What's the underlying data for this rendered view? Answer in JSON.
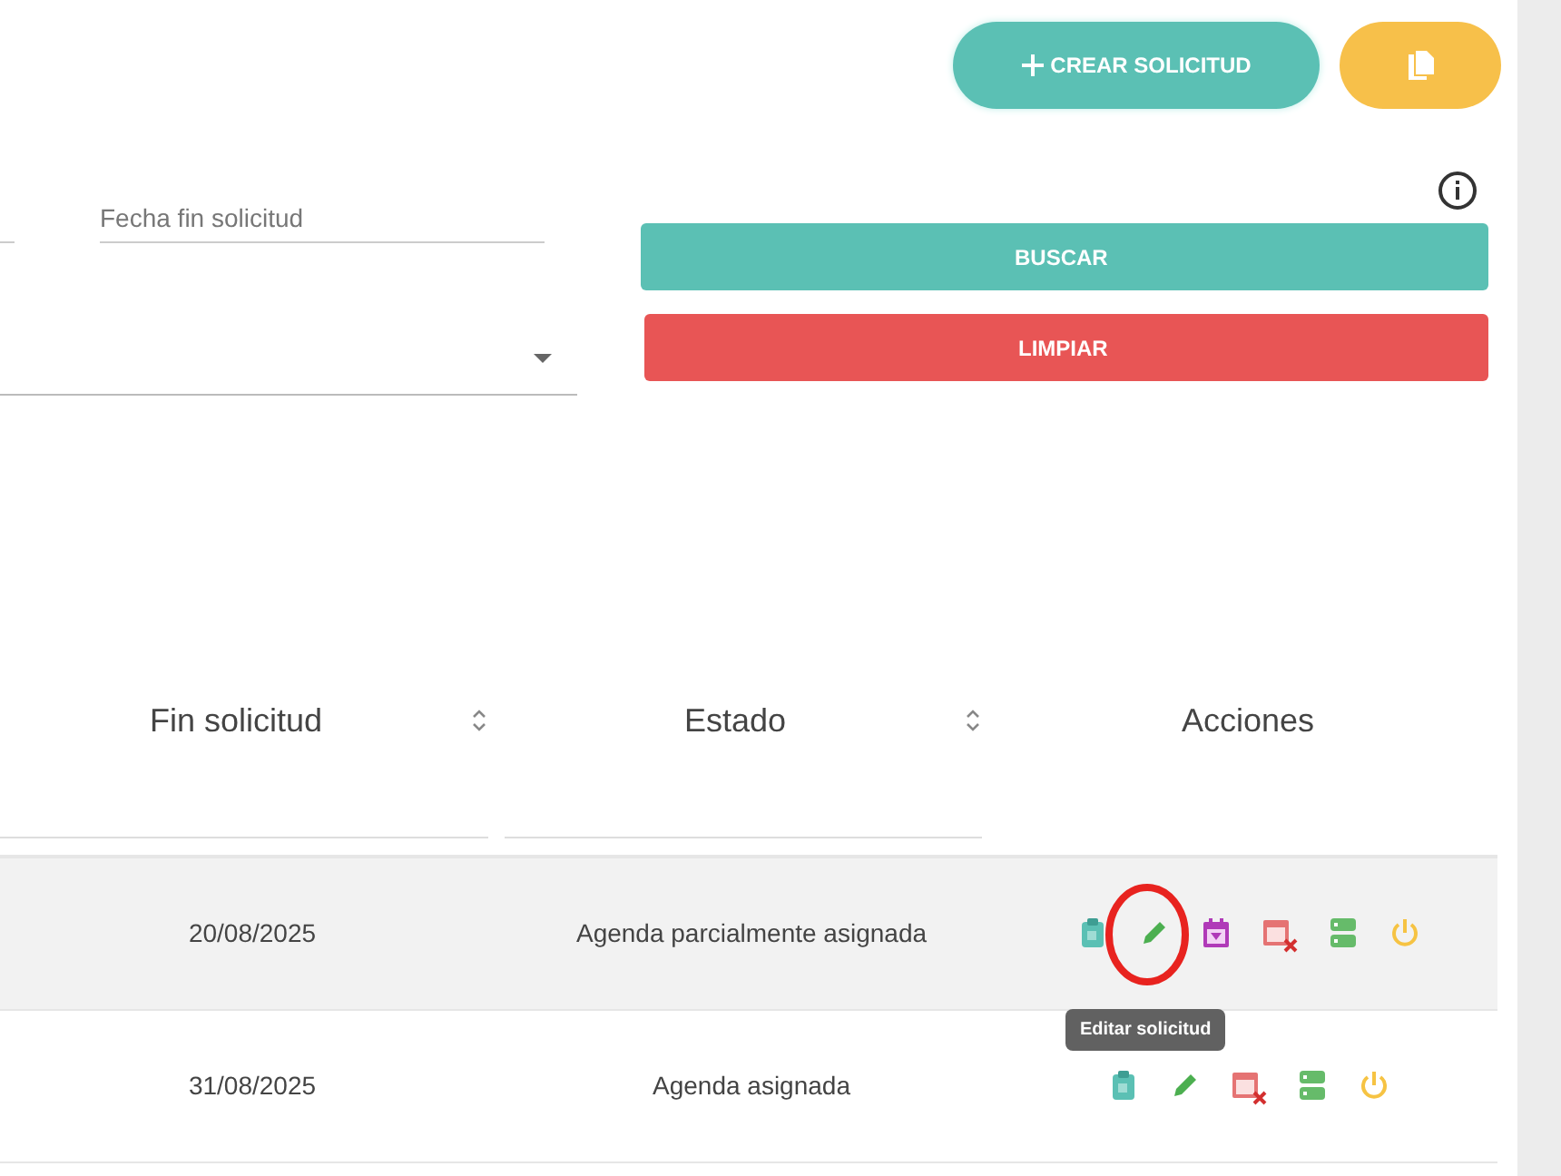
{
  "header_buttons": [
    {
      "kind": "create",
      "label": "CREAR SOLICITUD"
    },
    {
      "kind": "copy"
    }
  ],
  "filters": {
    "date_field": {
      "placeholder": "Fecha fin solicitud"
    },
    "select": {
      "kind": "dropdown"
    }
  },
  "filter_buttons": [
    {
      "kind": "search",
      "label": "BUSCAR"
    },
    {
      "kind": "clear",
      "label": "LIMPIAR"
    }
  ],
  "table": {
    "columns": [
      {
        "label": "Fin solicitud",
        "sortable": true,
        "filter": true
      },
      {
        "label": "Estado",
        "sortable": true,
        "filter": true
      },
      {
        "label": "Acciones",
        "sortable": false,
        "filter": false
      }
    ],
    "rows": [
      {
        "fin_solicitud": "20/08/2025",
        "estado": "Agenda parcialmente asignada",
        "hovered": true,
        "actions": [
          {
            "kind": "clipboard"
          },
          {
            "kind": "edit"
          },
          {
            "kind": "calendar"
          },
          {
            "kind": "calendar-cancel"
          },
          {
            "kind": "server"
          },
          {
            "kind": "power"
          }
        ]
      },
      {
        "fin_solicitud": "31/08/2025",
        "estado": "Agenda asignada",
        "hovered": false,
        "actions": [
          {
            "kind": "clipboard"
          },
          {
            "kind": "edit"
          },
          {
            "kind": "calendar-cancel"
          },
          {
            "kind": "server"
          },
          {
            "kind": "power"
          }
        ]
      }
    ]
  },
  "tooltip": {
    "text": "Editar solicitud"
  }
}
